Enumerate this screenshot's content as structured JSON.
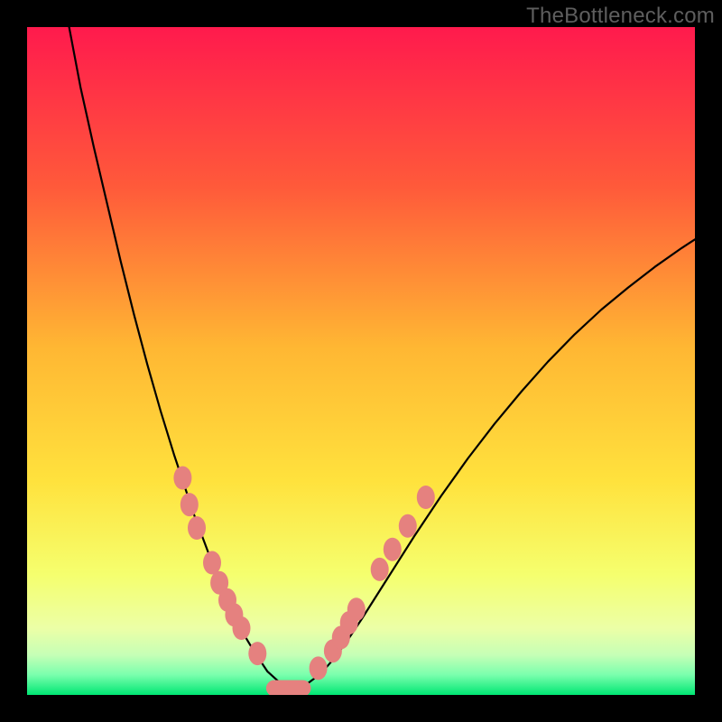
{
  "watermark": "TheBottleneck.com",
  "chart_data": {
    "type": "line",
    "title": "",
    "xlabel": "",
    "ylabel": "",
    "xlim": [
      0,
      100
    ],
    "ylim": [
      0,
      100
    ],
    "background_gradient": [
      "#ff1a4d",
      "#ff6a33",
      "#ffd633",
      "#f7ff66",
      "#d6ffb3",
      "#00e673"
    ],
    "note": "Axis values estimated from plot pixels; no tick labels present in source image.",
    "series": [
      {
        "name": "bottleneck-curve",
        "x": [
          6.3,
          8,
          10,
          12,
          14,
          16,
          18,
          20,
          22,
          23.5,
          25,
          26.5,
          28,
          29.5,
          31,
          32.5,
          34,
          36,
          38,
          40,
          42,
          44,
          46,
          48,
          50,
          54,
          58,
          62,
          66,
          70,
          74,
          78,
          82,
          86,
          90,
          94,
          98,
          100
        ],
        "y": [
          100,
          91,
          82,
          73.5,
          65,
          57,
          49.5,
          42.5,
          36,
          31.5,
          27,
          23,
          19,
          15.5,
          12,
          9,
          6.5,
          3.5,
          1.7,
          1,
          1.7,
          3.2,
          5.5,
          8.2,
          11.2,
          17.5,
          23.8,
          29.8,
          35.4,
          40.6,
          45.4,
          49.9,
          54,
          57.7,
          61,
          64.1,
          66.9,
          68.2
        ]
      }
    ],
    "markers": {
      "left_branch": [
        {
          "x": 23.3,
          "y": 32.5
        },
        {
          "x": 24.3,
          "y": 28.5
        },
        {
          "x": 25.4,
          "y": 25.0
        },
        {
          "x": 27.7,
          "y": 19.8
        },
        {
          "x": 28.8,
          "y": 16.8
        },
        {
          "x": 30.0,
          "y": 14.2
        },
        {
          "x": 31.0,
          "y": 12.0
        },
        {
          "x": 32.1,
          "y": 10.0
        },
        {
          "x": 34.5,
          "y": 6.2
        }
      ],
      "right_branch": [
        {
          "x": 43.6,
          "y": 4.0
        },
        {
          "x": 45.8,
          "y": 6.6
        },
        {
          "x": 47.0,
          "y": 8.6
        },
        {
          "x": 48.2,
          "y": 10.8
        },
        {
          "x": 49.3,
          "y": 12.8
        },
        {
          "x": 52.8,
          "y": 18.8
        },
        {
          "x": 54.7,
          "y": 21.8
        },
        {
          "x": 57.0,
          "y": 25.3
        },
        {
          "x": 59.7,
          "y": 29.6
        }
      ],
      "bottom_bar": {
        "x0": 35.8,
        "x1": 42.5,
        "y": 1.0
      }
    }
  }
}
